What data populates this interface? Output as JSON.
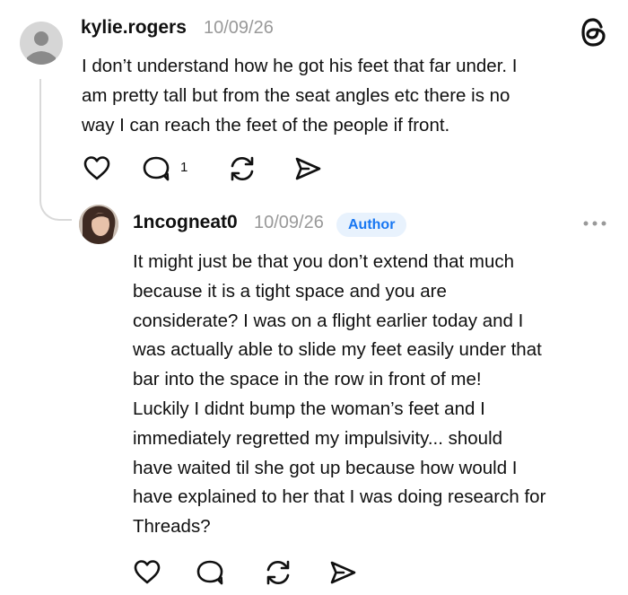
{
  "post": {
    "username": "kylie.rogers",
    "timestamp": "10/09/26",
    "body": "I don’t understand how he got his feet that far under. I\nam pretty tall but from the seat angles etc there is no\nway I can reach the feet of the people if front.",
    "reply_count": "1",
    "avatar_icon": "default-avatar-icon",
    "brand_icon": "threads-logo-icon"
  },
  "reply": {
    "username": "1ncogneat0",
    "timestamp": "10/09/26",
    "badge": "Author",
    "body": "It might just be that you don’t extend that much\nbecause it is a tight space and you are\nconsiderate? I was on a flight earlier today and I\nwas actually able to slide my feet easily under that\nbar into the space in the row in front of me!\nLuckily I didnt bump the woman’s feet and I\nimmediately regretted my impulsivity... should\nhave waited til she got up because how would I\nhave explained to her that I was doing research for\nThreads?"
  },
  "actions": [
    "heart-icon",
    "comment-icon",
    "repost-icon",
    "share-icon"
  ],
  "colors": {
    "text": "#101010",
    "secondary": "#999999",
    "badge_bg": "#e8f2fd",
    "badge_text": "#1877f2",
    "divider": "#d9d9d9"
  }
}
